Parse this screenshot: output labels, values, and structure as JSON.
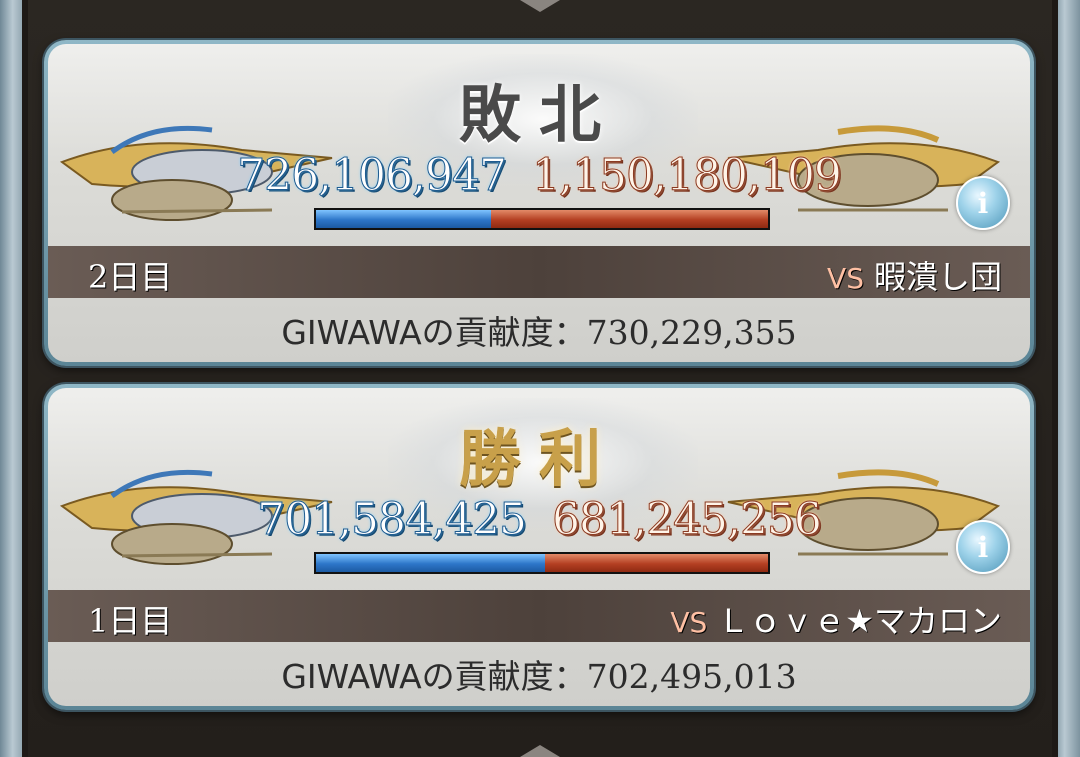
{
  "battles": [
    {
      "result": "敗北",
      "our_score": "726,106,947",
      "enemy_score": "1,150,180,109",
      "our_ratio": 0.387,
      "day": "2日目",
      "vs_prefix": "VS",
      "opponent": "暇潰し団",
      "contrib_label": "GIWAWAの貢献度：",
      "contrib_value": "730,229,355"
    },
    {
      "result": "勝利",
      "our_score": "701,584,425",
      "enemy_score": "681,245,256",
      "our_ratio": 0.507,
      "day": "1日目",
      "vs_prefix": "VS",
      "opponent": "Ｌｏｖｅ★マカロン",
      "contrib_label": "GIWAWAの貢献度：",
      "contrib_value": "702,495,013"
    }
  ],
  "info_glyph": "i",
  "colors": {
    "our_bar": "#2d76c9",
    "enemy_bar": "#b43f22",
    "defeat_title": "#4a4a4a",
    "victory_title": "#c8a04a"
  }
}
